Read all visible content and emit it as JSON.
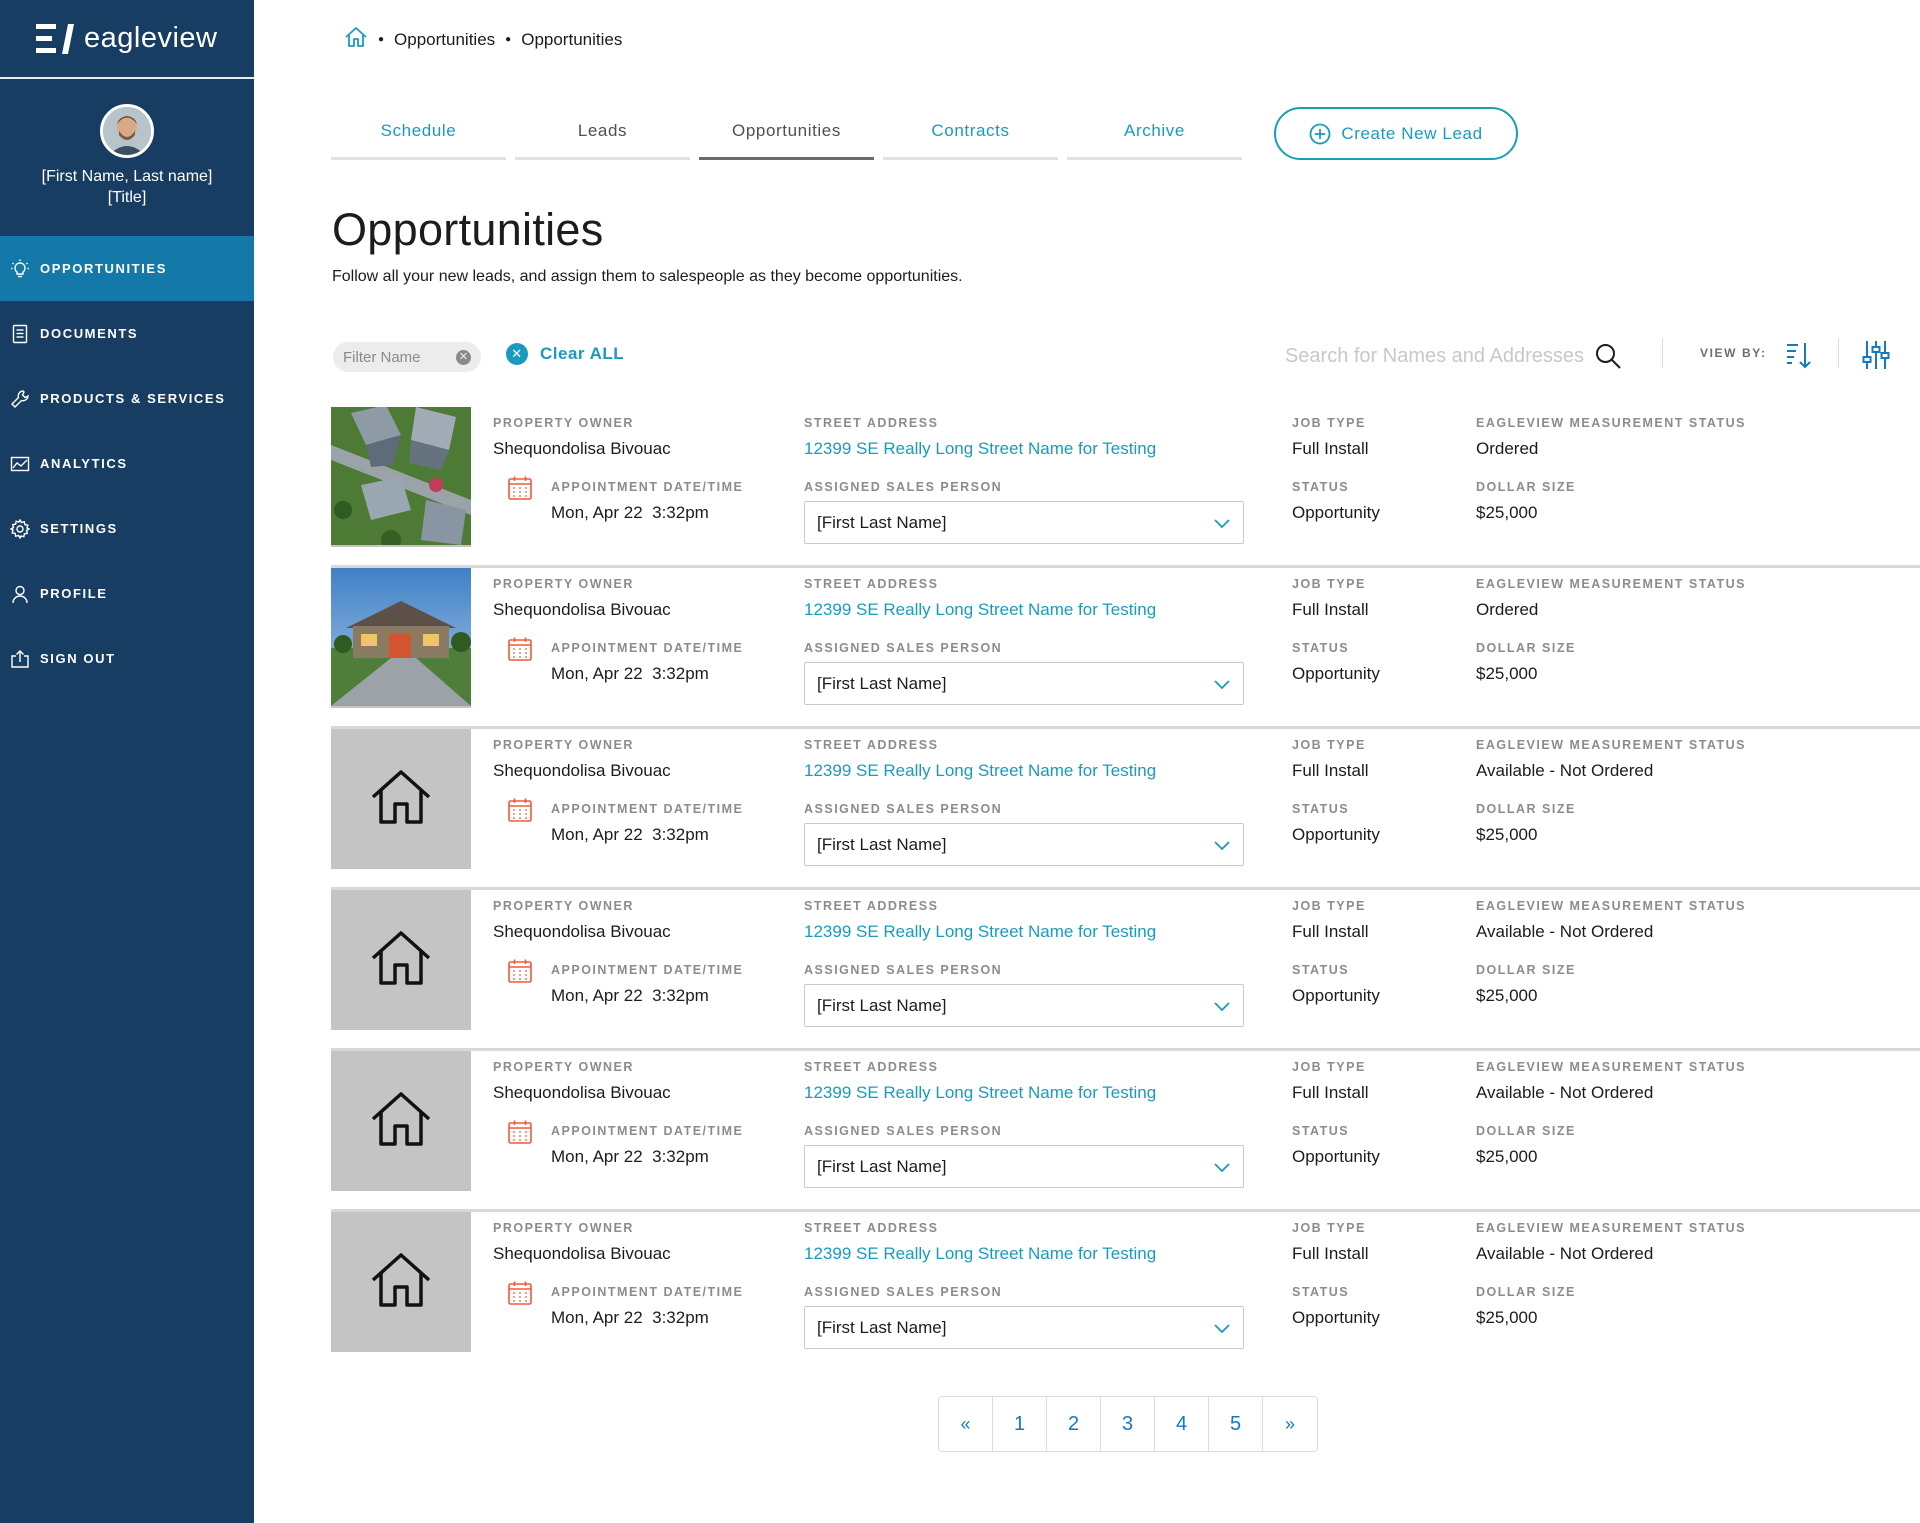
{
  "brand": {
    "name": "eagleview"
  },
  "user": {
    "name": "[First Name, Last name]",
    "title": "[Title]"
  },
  "nav": [
    {
      "label": "OPPORTUNITIES",
      "icon": "lightbulb-icon",
      "active": true
    },
    {
      "label": "DOCUMENTS",
      "icon": "document-icon",
      "active": false
    },
    {
      "label": "PRODUCTS & SERVICES",
      "icon": "wrench-icon",
      "active": false
    },
    {
      "label": "ANALYTICS",
      "icon": "analytics-icon",
      "active": false
    },
    {
      "label": "SETTINGS",
      "icon": "gear-icon",
      "active": false
    },
    {
      "label": "PROFILE",
      "icon": "person-icon",
      "active": false
    },
    {
      "label": "SIGN OUT",
      "icon": "sign-out-icon",
      "active": false
    }
  ],
  "breadcrumb": [
    "Opportunities",
    "Opportunities"
  ],
  "tabs": [
    {
      "label": "Schedule"
    },
    {
      "label": "Leads"
    },
    {
      "label": "Opportunities"
    },
    {
      "label": "Contracts"
    },
    {
      "label": "Archive"
    }
  ],
  "active_tab": "Opportunities",
  "create_button": "Create New Lead",
  "page": {
    "title": "Opportunities",
    "subtitle": "Follow all your new leads, and assign them to salespeople as they become opportunities."
  },
  "filters": {
    "chip_label": "Filter Name",
    "clear_all": "Clear ALL",
    "search_placeholder": "Search for Names and Addresses",
    "view_by": "VIEW BY:"
  },
  "labels": {
    "property_owner": "PROPERTY OWNER",
    "appointment": "APPOINTMENT DATE/TIME",
    "street_address": "STREET ADDRESS",
    "assigned_sales": "ASSIGNED SALES PERSON",
    "job_type": "JOB TYPE",
    "status": "STATUS",
    "measurement_status": "EAGLEVIEW MEASUREMENT STATUS",
    "dollar_size": "DOLLAR SIZE"
  },
  "rows": [
    {
      "thumb": "aerial-photo",
      "owner": "Shequondolisa Bivouac",
      "appointment": "Mon, Apr 22  3:32pm",
      "address": "12399 SE Really Long Street Name for Testing",
      "sales_person": "[First Last Name]",
      "job_type": "Full Install",
      "status": "Opportunity",
      "measurement_status": "Ordered",
      "dollar_size": "$25,000"
    },
    {
      "thumb": "house-photo",
      "owner": "Shequondolisa Bivouac",
      "appointment": "Mon, Apr 22  3:32pm",
      "address": "12399 SE Really Long Street Name for Testing",
      "sales_person": "[First Last Name]",
      "job_type": "Full Install",
      "status": "Opportunity",
      "measurement_status": "Ordered",
      "dollar_size": "$25,000"
    },
    {
      "thumb": "placeholder",
      "owner": "Shequondolisa Bivouac",
      "appointment": "Mon, Apr 22  3:32pm",
      "address": "12399 SE Really Long Street Name for Testing",
      "sales_person": "[First Last Name]",
      "job_type": "Full Install",
      "status": "Opportunity",
      "measurement_status": "Available - Not Ordered",
      "dollar_size": "$25,000"
    },
    {
      "thumb": "placeholder",
      "owner": "Shequondolisa Bivouac",
      "appointment": "Mon, Apr 22  3:32pm",
      "address": "12399 SE Really Long Street Name for Testing",
      "sales_person": "[First Last Name]",
      "job_type": "Full Install",
      "status": "Opportunity",
      "measurement_status": "Available - Not Ordered",
      "dollar_size": "$25,000"
    },
    {
      "thumb": "placeholder",
      "owner": "Shequondolisa Bivouac",
      "appointment": "Mon, Apr 22  3:32pm",
      "address": "12399 SE Really Long Street Name for Testing",
      "sales_person": "[First Last Name]",
      "job_type": "Full Install",
      "status": "Opportunity",
      "measurement_status": "Available - Not Ordered",
      "dollar_size": "$25,000"
    },
    {
      "thumb": "placeholder",
      "owner": "Shequondolisa Bivouac",
      "appointment": "Mon, Apr 22  3:32pm",
      "address": "12399 SE Really Long Street Name for Testing",
      "sales_person": "[First Last Name]",
      "job_type": "Full Install",
      "status": "Opportunity",
      "measurement_status": "Available - Not Ordered",
      "dollar_size": "$25,000"
    }
  ],
  "pagination": {
    "prev": "«",
    "pages": [
      "1",
      "2",
      "3",
      "4",
      "5"
    ],
    "next": "»"
  },
  "colors": {
    "sidebar": "#173d63",
    "active_nav": "#1479a9",
    "accent": "#1a9bbd",
    "calendar": "#ee5a3c"
  }
}
